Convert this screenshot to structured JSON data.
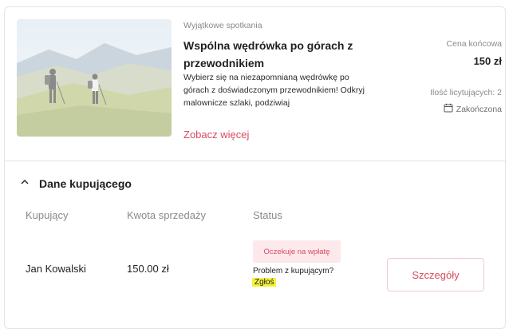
{
  "listing": {
    "category": "Wyjątkowe spotkania",
    "title": "Wspólna wędrówka po górach z przewodnikiem",
    "description": "Wybierz się na niezapomnianą wędrówkę po górach z doświadczonym przewodnikiem! Odkryj malownicze szlaki, podziwiaj",
    "more_link": "Zobacz więcej",
    "price_label": "Cena końcowa",
    "price_value": "150 zł",
    "bidders_label": "Ilość licytujących: 2",
    "status_label": "Zakończona",
    "image_icon": "hikers-photo"
  },
  "buyer_section": {
    "title": "Dane kupującego",
    "toggle_icon": "chevron-up-icon",
    "columns": {
      "buyer": "Kupujący",
      "amount": "Kwota sprzedaży",
      "status": "Status"
    },
    "row": {
      "buyer_name": "Jan Kowalski",
      "amount": "150.00 zł",
      "status_badge": "Oczekuje na wpłatę",
      "problem_text": "Problem z kupującym?",
      "report_link": "Zgłoś",
      "details_button": "Szczegóły"
    }
  },
  "colors": {
    "accent": "#d84b5f",
    "badge_bg": "#fde8ec",
    "highlight": "#f4f23c",
    "border": "#e4e4e4"
  }
}
